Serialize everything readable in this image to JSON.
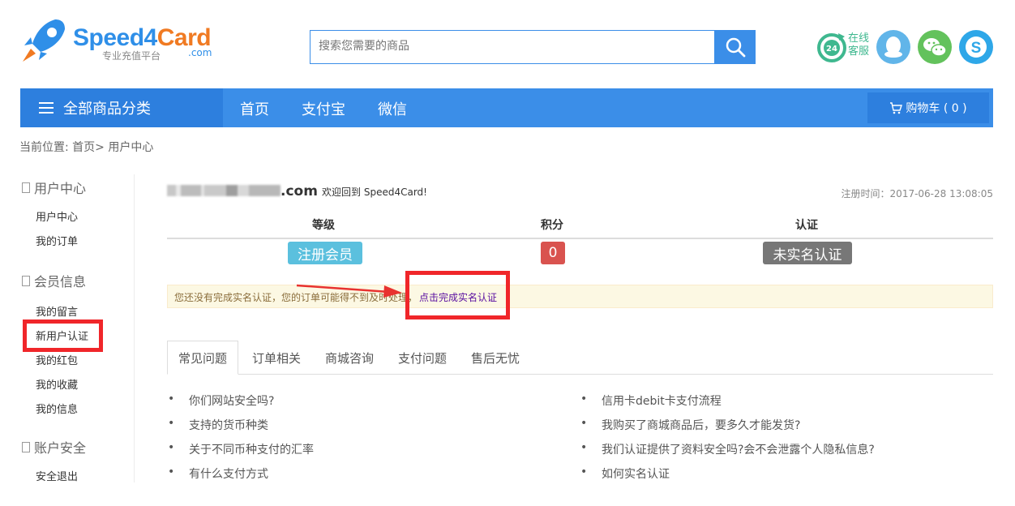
{
  "logo": {
    "brand_a": "Speed4",
    "brand_b": "Card",
    "subtitle": "专业充值平台",
    "domain": ".com"
  },
  "search": {
    "placeholder": "搜索您需要的商品",
    "value": ""
  },
  "service": {
    "online": "在线",
    "service": "客服",
    "hours": "24"
  },
  "nav": {
    "all_categories": "全部商品分类",
    "links": [
      "首页",
      "支付宝",
      "微信"
    ],
    "cart": "购物车 ( 0 )"
  },
  "breadcrumb": "当前位置: 首页> 用户中心",
  "sidebar": {
    "sections": [
      {
        "title": "用户中心",
        "items": [
          "用户中心",
          "我的订单"
        ]
      },
      {
        "title": "会员信息",
        "items": [
          "我的留言",
          "新用户认证",
          "我的红包",
          "我的收藏",
          "我的信息"
        ]
      },
      {
        "title": "账户安全",
        "items": [
          "安全退出"
        ]
      }
    ]
  },
  "user": {
    "email_domain": ".com",
    "welcome": "欢迎回到 Speed4Card!",
    "reg_time": "注册时间：2017-06-28 13:08:05"
  },
  "stats": {
    "headers": [
      "等级",
      "积分",
      "认证"
    ],
    "level": "注册会员",
    "points": "0",
    "verification": "未实名认证"
  },
  "alert": {
    "message": "您还没有完成实名认证，您的订单可能得不到及时处理，",
    "link": "点击完成实名认证"
  },
  "tabs": [
    "常见问题",
    "订单相关",
    "商城咨询",
    "支付问题",
    "售后无忧"
  ],
  "faq": {
    "left": [
      "你们网站安全吗?",
      "支持的货币种类",
      "关于不同币种支付的汇率",
      "有什么支付方式"
    ],
    "right": [
      "信用卡debit卡支付流程",
      "我购买了商城商品后，要多久才能发货?",
      "我们认证提供了资料安全吗?会不会泄露个人隐私信息?",
      "如何实名认证"
    ]
  },
  "colors": {
    "primary": "#3b8ee8",
    "primary_dark": "#2d7fde",
    "highlight": "#f0262a",
    "orange": "#f07a22"
  }
}
